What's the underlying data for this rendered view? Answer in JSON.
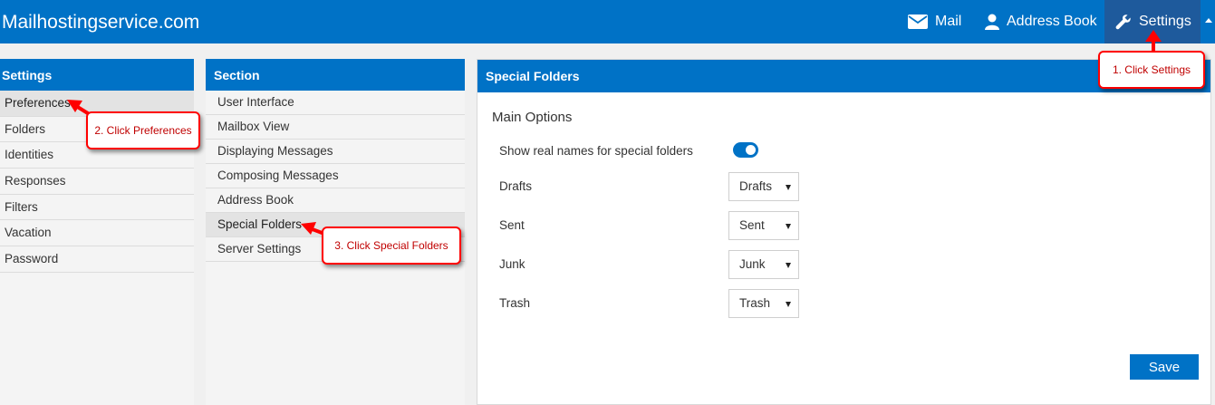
{
  "topbar": {
    "brand": "Mailhostingservice.com",
    "nav": {
      "mail": "Mail",
      "address_book": "Address Book",
      "settings": "Settings"
    }
  },
  "settings_panel": {
    "title": "Settings",
    "items": [
      "Preferences",
      "Folders",
      "Identities",
      "Responses",
      "Filters",
      "Vacation",
      "Password"
    ],
    "active": "Preferences"
  },
  "section_panel": {
    "title": "Section",
    "items": [
      "User Interface",
      "Mailbox View",
      "Displaying Messages",
      "Composing Messages",
      "Address Book",
      "Special Folders",
      "Server Settings"
    ],
    "active": "Special Folders"
  },
  "main_panel": {
    "title": "Special Folders",
    "group_title": "Main Options",
    "show_real_names": {
      "label": "Show real names for special folders",
      "enabled": true
    },
    "folders": [
      {
        "label": "Drafts",
        "value": "Drafts"
      },
      {
        "label": "Sent",
        "value": "Sent"
      },
      {
        "label": "Junk",
        "value": "Junk"
      },
      {
        "label": "Trash",
        "value": "Trash"
      }
    ],
    "save_label": "Save"
  },
  "callouts": {
    "step1": "1. Click Settings",
    "step2": "2. Click Preferences",
    "step3": "3. Click Special Folders"
  },
  "colors": {
    "accent": "#0072c6",
    "settings_active_bg": "#1e5a9c",
    "callout": "#ff0000",
    "callout_text": "#c00000"
  }
}
